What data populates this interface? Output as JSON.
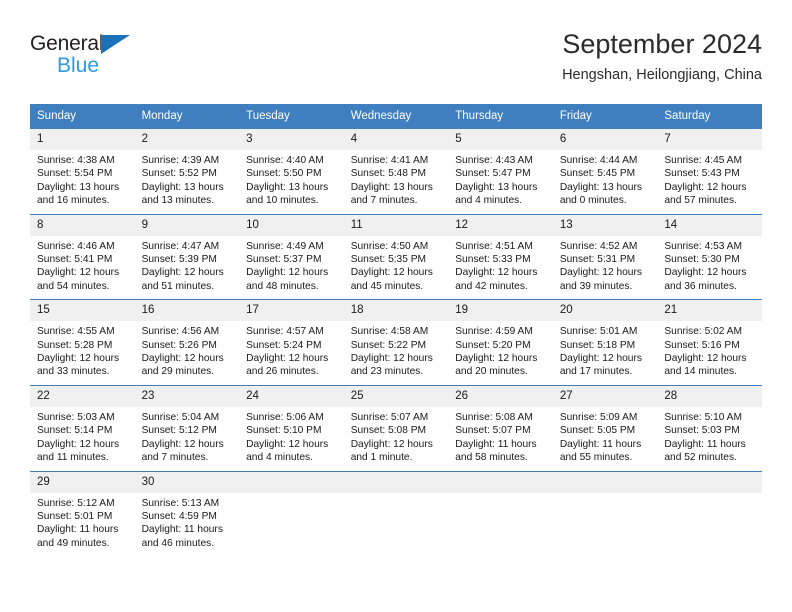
{
  "logo": {
    "word_top": "General",
    "word_bottom": "Blue",
    "triangle_color": "#1b72b8",
    "bottom_color": "#2e9ae0"
  },
  "header": {
    "title": "September 2024",
    "location": "Hengshan, Heilongjiang, China"
  },
  "theme": {
    "header_blue": "#3f7fbf",
    "daynum_gray": "#f0f0f0",
    "text": "#1a1a1a"
  },
  "weekdays": [
    "Sunday",
    "Monday",
    "Tuesday",
    "Wednesday",
    "Thursday",
    "Friday",
    "Saturday"
  ],
  "weeks": [
    [
      {
        "day": "1",
        "sunrise": "Sunrise: 4:38 AM",
        "sunset": "Sunset: 5:54 PM",
        "daylight": "Daylight: 13 hours and 16 minutes."
      },
      {
        "day": "2",
        "sunrise": "Sunrise: 4:39 AM",
        "sunset": "Sunset: 5:52 PM",
        "daylight": "Daylight: 13 hours and 13 minutes."
      },
      {
        "day": "3",
        "sunrise": "Sunrise: 4:40 AM",
        "sunset": "Sunset: 5:50 PM",
        "daylight": "Daylight: 13 hours and 10 minutes."
      },
      {
        "day": "4",
        "sunrise": "Sunrise: 4:41 AM",
        "sunset": "Sunset: 5:48 PM",
        "daylight": "Daylight: 13 hours and 7 minutes."
      },
      {
        "day": "5",
        "sunrise": "Sunrise: 4:43 AM",
        "sunset": "Sunset: 5:47 PM",
        "daylight": "Daylight: 13 hours and 4 minutes."
      },
      {
        "day": "6",
        "sunrise": "Sunrise: 4:44 AM",
        "sunset": "Sunset: 5:45 PM",
        "daylight": "Daylight: 13 hours and 0 minutes."
      },
      {
        "day": "7",
        "sunrise": "Sunrise: 4:45 AM",
        "sunset": "Sunset: 5:43 PM",
        "daylight": "Daylight: 12 hours and 57 minutes."
      }
    ],
    [
      {
        "day": "8",
        "sunrise": "Sunrise: 4:46 AM",
        "sunset": "Sunset: 5:41 PM",
        "daylight": "Daylight: 12 hours and 54 minutes."
      },
      {
        "day": "9",
        "sunrise": "Sunrise: 4:47 AM",
        "sunset": "Sunset: 5:39 PM",
        "daylight": "Daylight: 12 hours and 51 minutes."
      },
      {
        "day": "10",
        "sunrise": "Sunrise: 4:49 AM",
        "sunset": "Sunset: 5:37 PM",
        "daylight": "Daylight: 12 hours and 48 minutes."
      },
      {
        "day": "11",
        "sunrise": "Sunrise: 4:50 AM",
        "sunset": "Sunset: 5:35 PM",
        "daylight": "Daylight: 12 hours and 45 minutes."
      },
      {
        "day": "12",
        "sunrise": "Sunrise: 4:51 AM",
        "sunset": "Sunset: 5:33 PM",
        "daylight": "Daylight: 12 hours and 42 minutes."
      },
      {
        "day": "13",
        "sunrise": "Sunrise: 4:52 AM",
        "sunset": "Sunset: 5:31 PM",
        "daylight": "Daylight: 12 hours and 39 minutes."
      },
      {
        "day": "14",
        "sunrise": "Sunrise: 4:53 AM",
        "sunset": "Sunset: 5:30 PM",
        "daylight": "Daylight: 12 hours and 36 minutes."
      }
    ],
    [
      {
        "day": "15",
        "sunrise": "Sunrise: 4:55 AM",
        "sunset": "Sunset: 5:28 PM",
        "daylight": "Daylight: 12 hours and 33 minutes."
      },
      {
        "day": "16",
        "sunrise": "Sunrise: 4:56 AM",
        "sunset": "Sunset: 5:26 PM",
        "daylight": "Daylight: 12 hours and 29 minutes."
      },
      {
        "day": "17",
        "sunrise": "Sunrise: 4:57 AM",
        "sunset": "Sunset: 5:24 PM",
        "daylight": "Daylight: 12 hours and 26 minutes."
      },
      {
        "day": "18",
        "sunrise": "Sunrise: 4:58 AM",
        "sunset": "Sunset: 5:22 PM",
        "daylight": "Daylight: 12 hours and 23 minutes."
      },
      {
        "day": "19",
        "sunrise": "Sunrise: 4:59 AM",
        "sunset": "Sunset: 5:20 PM",
        "daylight": "Daylight: 12 hours and 20 minutes."
      },
      {
        "day": "20",
        "sunrise": "Sunrise: 5:01 AM",
        "sunset": "Sunset: 5:18 PM",
        "daylight": "Daylight: 12 hours and 17 minutes."
      },
      {
        "day": "21",
        "sunrise": "Sunrise: 5:02 AM",
        "sunset": "Sunset: 5:16 PM",
        "daylight": "Daylight: 12 hours and 14 minutes."
      }
    ],
    [
      {
        "day": "22",
        "sunrise": "Sunrise: 5:03 AM",
        "sunset": "Sunset: 5:14 PM",
        "daylight": "Daylight: 12 hours and 11 minutes."
      },
      {
        "day": "23",
        "sunrise": "Sunrise: 5:04 AM",
        "sunset": "Sunset: 5:12 PM",
        "daylight": "Daylight: 12 hours and 7 minutes."
      },
      {
        "day": "24",
        "sunrise": "Sunrise: 5:06 AM",
        "sunset": "Sunset: 5:10 PM",
        "daylight": "Daylight: 12 hours and 4 minutes."
      },
      {
        "day": "25",
        "sunrise": "Sunrise: 5:07 AM",
        "sunset": "Sunset: 5:08 PM",
        "daylight": "Daylight: 12 hours and 1 minute."
      },
      {
        "day": "26",
        "sunrise": "Sunrise: 5:08 AM",
        "sunset": "Sunset: 5:07 PM",
        "daylight": "Daylight: 11 hours and 58 minutes."
      },
      {
        "day": "27",
        "sunrise": "Sunrise: 5:09 AM",
        "sunset": "Sunset: 5:05 PM",
        "daylight": "Daylight: 11 hours and 55 minutes."
      },
      {
        "day": "28",
        "sunrise": "Sunrise: 5:10 AM",
        "sunset": "Sunset: 5:03 PM",
        "daylight": "Daylight: 11 hours and 52 minutes."
      }
    ],
    [
      {
        "day": "29",
        "sunrise": "Sunrise: 5:12 AM",
        "sunset": "Sunset: 5:01 PM",
        "daylight": "Daylight: 11 hours and 49 minutes."
      },
      {
        "day": "30",
        "sunrise": "Sunrise: 5:13 AM",
        "sunset": "Sunset: 4:59 PM",
        "daylight": "Daylight: 11 hours and 46 minutes."
      },
      {
        "day": "",
        "sunrise": "",
        "sunset": "",
        "daylight": ""
      },
      {
        "day": "",
        "sunrise": "",
        "sunset": "",
        "daylight": ""
      },
      {
        "day": "",
        "sunrise": "",
        "sunset": "",
        "daylight": ""
      },
      {
        "day": "",
        "sunrise": "",
        "sunset": "",
        "daylight": ""
      },
      {
        "day": "",
        "sunrise": "",
        "sunset": "",
        "daylight": ""
      }
    ]
  ]
}
